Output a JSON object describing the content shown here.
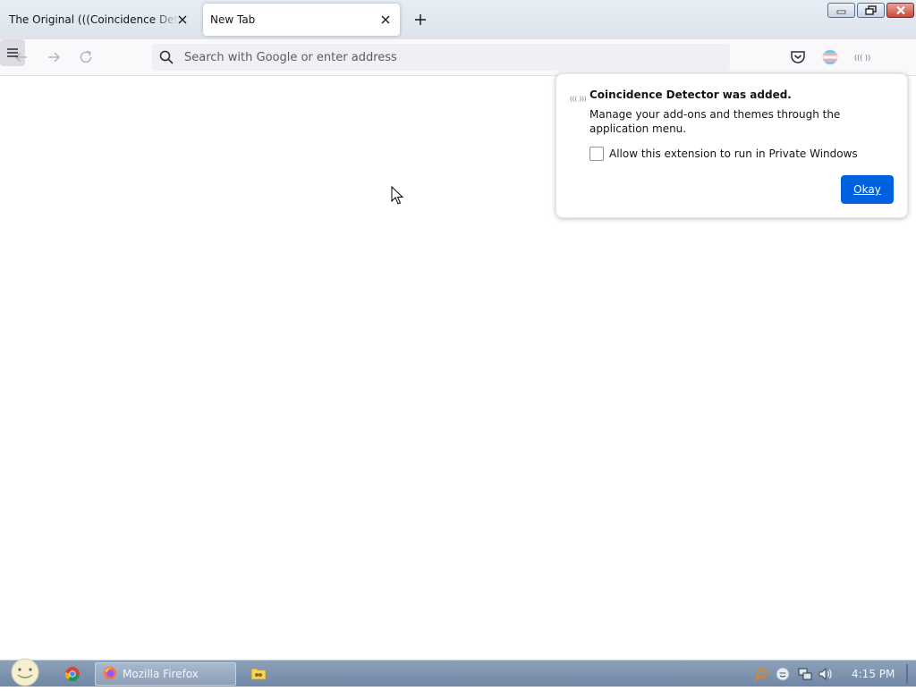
{
  "browser": {
    "tabs": [
      {
        "label": "The Original (((Coincidence Detector",
        "active": false
      },
      {
        "label": "New Tab",
        "active": true
      }
    ],
    "address_bar": {
      "placeholder": "Search with Google or enter address",
      "value": ""
    },
    "icons": {
      "back": "back-arrow-icon",
      "forward": "forward-arrow-icon",
      "reload": "reload-icon",
      "search": "search-icon",
      "pocket": "pocket-icon",
      "account": "account-icon",
      "extension": "coincidence-detector-icon",
      "menu": "hamburger-menu-icon"
    }
  },
  "doorhanger": {
    "title": "Coincidence Detector was added.",
    "description": "Manage your add-ons and themes through the application menu.",
    "checkbox_label": "Allow this extension to run in Private Windows",
    "checkbox_checked": false,
    "button_label": "Okay"
  },
  "taskbar": {
    "firefox_task_label": "Mozilla Firefox",
    "clock": "4:15 PM"
  },
  "colors": {
    "accent": "#0061e0",
    "taskbar": "#7a90ac"
  }
}
